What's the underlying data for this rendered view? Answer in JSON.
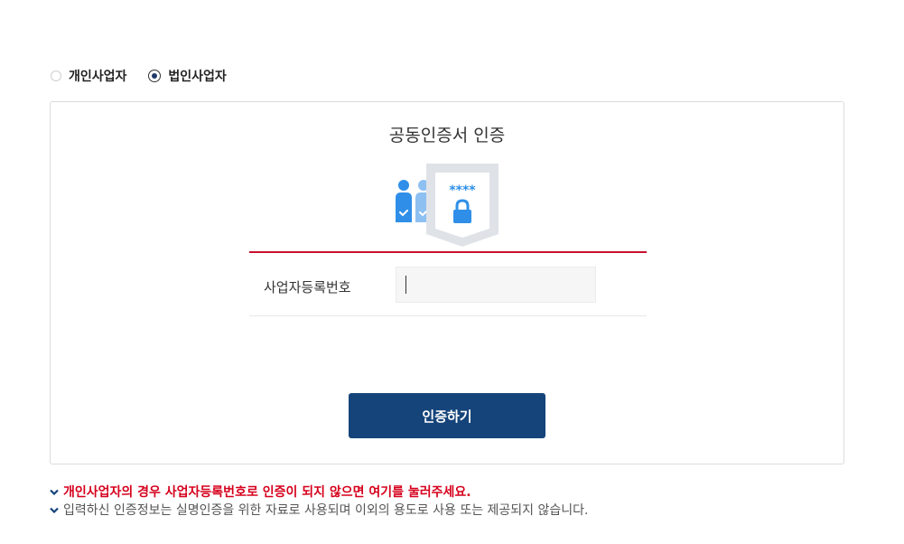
{
  "business_type": {
    "options": [
      {
        "label": "개인사업자",
        "checked": false
      },
      {
        "label": "법인사업자",
        "checked": true
      }
    ]
  },
  "auth_panel": {
    "title": "공동인증서 인증",
    "illustration_text": "****",
    "field": {
      "label": "사업자등록번호",
      "value": "",
      "placeholder": ""
    },
    "submit_label": "인증하기"
  },
  "notes": {
    "personal_link": "개인사업자의 경우 사업자등록번호로 인증이 되지 않으면 여기를 눌러주세요.",
    "privacy": "입력하신 인증정보는 실명인증을 위한 자료로 사용되며 이외의 용도로 사용 또는 제공되지 않습니다."
  },
  "colors": {
    "brand_navy": "#15447a",
    "accent_red": "#c8102e",
    "illustration_blue": "#2f8fe8"
  }
}
